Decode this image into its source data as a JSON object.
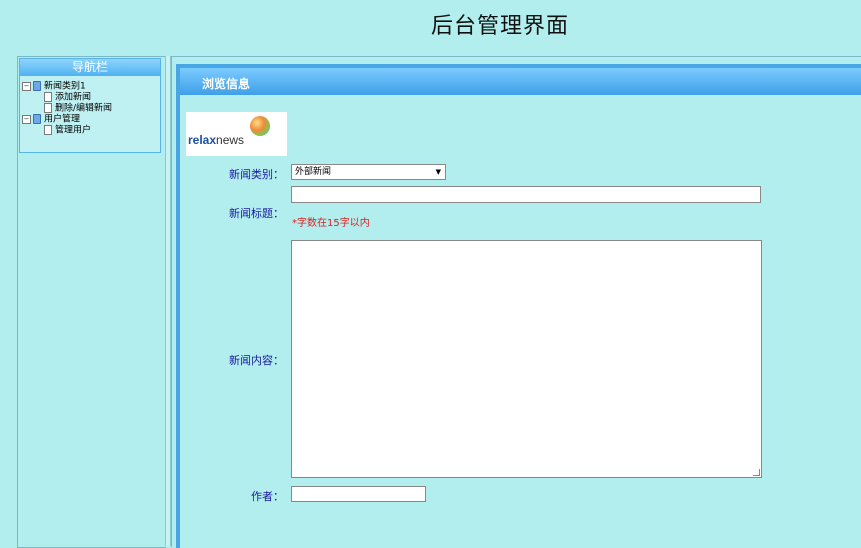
{
  "page_title": "后台管理界面",
  "nav": {
    "header": "导航栏",
    "tree": [
      {
        "toggle": "−",
        "icon": "folder",
        "label": "新闻类别1"
      },
      {
        "toggle": "",
        "icon": "doc",
        "label": "添加新闻"
      },
      {
        "toggle": "",
        "icon": "doc",
        "label": "删除/编辑新闻"
      },
      {
        "toggle": "−",
        "icon": "folder",
        "label": "用户管理"
      },
      {
        "toggle": "",
        "icon": "doc",
        "label": "管理用户"
      }
    ]
  },
  "main": {
    "header": "浏览信息",
    "logo": {
      "part1": "relax",
      "part2": "news"
    },
    "form": {
      "category_label": "新闻类别：",
      "category_value": "外部新闻",
      "title_label": "新闻标题：",
      "title_value": "",
      "title_hint": "*字数在15字以内",
      "content_label": "新闻内容：",
      "content_value": "",
      "author_label": "作者：",
      "author_value": ""
    }
  },
  "colors": {
    "background": "#b3eeef",
    "accent": "#49a6e5",
    "label": "#1a1aa0",
    "hint": "#e02020"
  }
}
